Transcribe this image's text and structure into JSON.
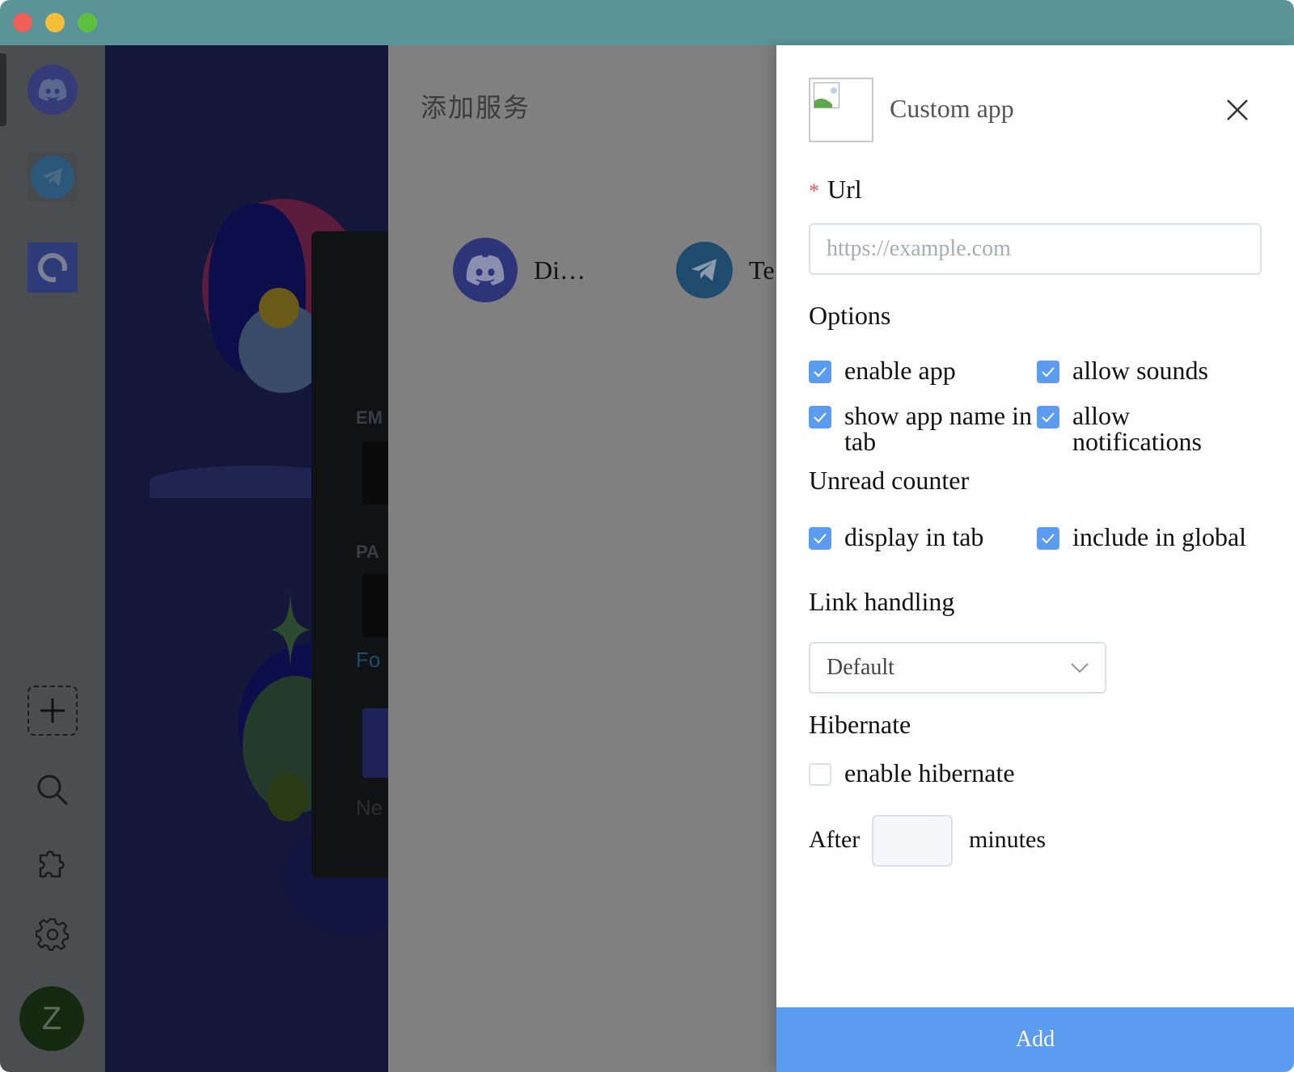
{
  "service_panel": {
    "title": "添加服务",
    "services": [
      {
        "name": "Di…",
        "icon": "discord-icon"
      },
      {
        "name": "Te",
        "icon": "telegram-icon"
      }
    ]
  },
  "webview": {
    "labels": [
      "EM",
      "PA"
    ],
    "link": "Fo",
    "footer": "Ne"
  },
  "dock": {
    "avatar_letter": "Z"
  },
  "drawer": {
    "title": "Custom app",
    "url": {
      "label": "Url",
      "required_mark": "*",
      "placeholder": "https://example.com",
      "value": ""
    },
    "options": {
      "label": "Options",
      "items": [
        {
          "label": "enable app",
          "checked": true
        },
        {
          "label": "allow sounds",
          "checked": true
        },
        {
          "label": "show app name in tab",
          "checked": true
        },
        {
          "label": "allow notifications",
          "checked": true
        }
      ]
    },
    "unread_counter": {
      "label": "Unread counter",
      "items": [
        {
          "label": "display in tab",
          "checked": true
        },
        {
          "label": "include in global",
          "checked": true
        }
      ]
    },
    "link_handling": {
      "label": "Link handling",
      "selected": "Default"
    },
    "hibernate": {
      "label": "Hibernate",
      "enable_label": "enable hibernate",
      "enabled": false,
      "after_label": "After",
      "minutes_value": "",
      "minutes_label": "minutes"
    },
    "submit_label": "Add"
  },
  "colors": {
    "titlebar": "#5b9498",
    "accent": "#5c9cf0",
    "discord": "#5865f2",
    "telegram": "#2a8bd0"
  }
}
